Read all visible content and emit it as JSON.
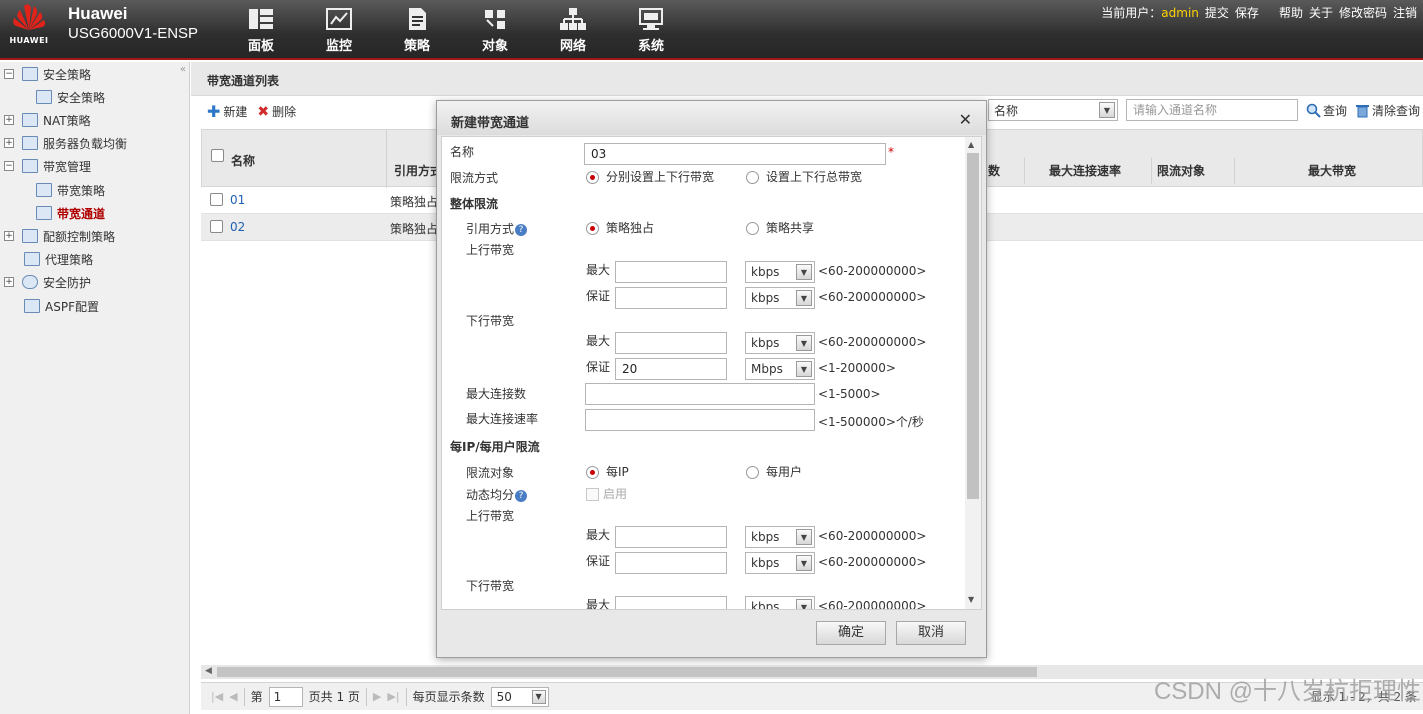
{
  "app": {
    "brand": "Huawei",
    "model": "USG6000V1-ENSP",
    "logo_word": "HUAWEI"
  },
  "nav": [
    {
      "label": "面板",
      "icon": "dashboard-icon"
    },
    {
      "label": "监控",
      "icon": "monitor-chart-icon"
    },
    {
      "label": "策略",
      "icon": "policy-document-icon"
    },
    {
      "label": "对象",
      "icon": "objects-icon"
    },
    {
      "label": "网络",
      "icon": "network-icon"
    },
    {
      "label": "系统",
      "icon": "system-icon"
    }
  ],
  "userbar": {
    "prefix": "当前用户：",
    "user": "admin",
    "submit": "提交",
    "save": "保存",
    "help": "帮助",
    "about": "关于",
    "change_pwd": "修改密码",
    "logout": "注销"
  },
  "sidebar": [
    {
      "label": "安全策略",
      "expander": "−"
    },
    {
      "label": "安全策略",
      "expander": ""
    },
    {
      "label": "NAT策略",
      "expander": "+"
    },
    {
      "label": "服务器负载均衡",
      "expander": "+"
    },
    {
      "label": "带宽管理",
      "expander": "−"
    },
    {
      "label": "带宽策略",
      "expander": ""
    },
    {
      "label": "带宽通道",
      "expander": ""
    },
    {
      "label": "配额控制策略",
      "expander": "+"
    },
    {
      "label": "代理策略",
      "expander": ""
    },
    {
      "label": "安全防护",
      "expander": "+"
    },
    {
      "label": "ASPF配置",
      "expander": ""
    }
  ],
  "page": {
    "title": "带宽通道列表",
    "new_label": "新建",
    "delete_label": "删除"
  },
  "search": {
    "field": "名称",
    "placeholder": "请输入通道名称",
    "query": "查询",
    "clear": "清除查询"
  },
  "table": {
    "headers": {
      "name": "名称",
      "ref": "引用方式",
      "conn_tail": "数",
      "max_rate": "最大连接速率",
      "limit_obj": "限流对象",
      "max_bw": "最大带宽"
    },
    "rows": [
      {
        "name": "01",
        "ref": "策略独占"
      },
      {
        "name": "02",
        "ref": "策略独占"
      }
    ]
  },
  "pager": {
    "page_prefix": "第",
    "page": "1",
    "page_suffix": "页共 1 页",
    "per_page_label": "每页显示条数",
    "per_page": "50",
    "summary": "显示 1 - 2，共 2 条"
  },
  "dialog": {
    "title": "新建带宽通道",
    "name_label": "名称",
    "name_value": "03",
    "required_mark": "*",
    "mode_label": "限流方式",
    "mode_opt1": "分别设置上下行带宽",
    "mode_opt2": "设置上下行总带宽",
    "overall_section": "整体限流",
    "ref_label": "引用方式",
    "ref_opt1": "策略独占",
    "ref_opt2": "策略共享",
    "up_label": "上行带宽",
    "down_label": "下行带宽",
    "max_label": "最大",
    "guar_label": "保证",
    "overall_fields": [
      {
        "value": "",
        "unit": "kbps",
        "hint": "<60-200000000>"
      },
      {
        "value": "",
        "unit": "kbps",
        "hint": "<60-200000000>"
      },
      {
        "value": "",
        "unit": "kbps",
        "hint": "<60-200000000>"
      },
      {
        "value": "20",
        "unit": "Mbps",
        "hint": "<1-200000>"
      }
    ],
    "max_conn_label": "最大连接数",
    "max_conn_hint": "<1-5000>",
    "max_conn_rate_label": "最大连接速率",
    "max_conn_rate_hint": "<1-500000>个/秒",
    "per_section": "每IP/每用户限流",
    "limit_obj_label": "限流对象",
    "limit_opt1": "每IP",
    "limit_opt2": "每用户",
    "dyn_label": "动态均分",
    "dyn_enable": "启用",
    "per_fields": [
      {
        "value": "",
        "unit": "kbps",
        "hint": "<60-200000000>"
      },
      {
        "value": "",
        "unit": "kbps",
        "hint": "<60-200000000>"
      },
      {
        "value": "",
        "unit": "kbps",
        "hint": "<60-200000000>"
      }
    ],
    "ok": "确定",
    "cancel": "取消",
    "help_mark": "?"
  },
  "watermark": "CSDN @十八岁杭拒理性",
  "colors": {
    "accent_red": "#c00000",
    "topbar": "#333333",
    "link_blue": "#1f5fb4",
    "admin_yellow": "#ffd200"
  }
}
